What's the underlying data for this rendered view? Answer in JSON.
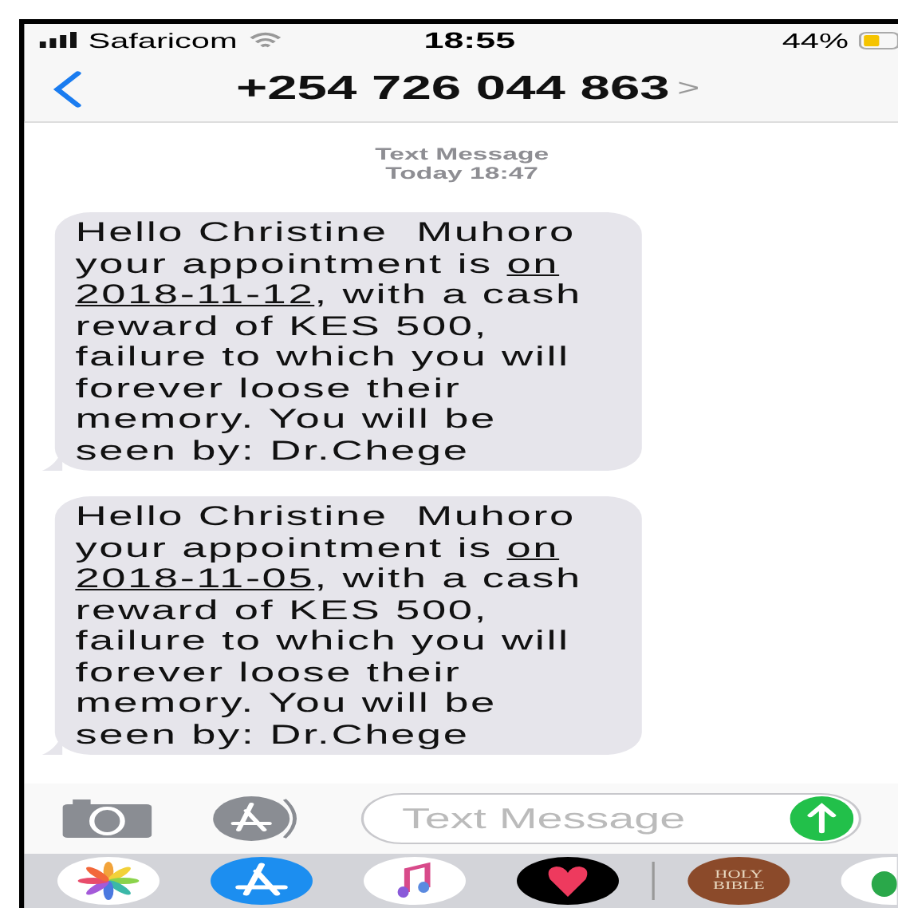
{
  "status_bar": {
    "carrier": "Safaricom",
    "time": "18:55",
    "battery": "44%"
  },
  "nav": {
    "title": "+254 726 044 863",
    "chevron": ">"
  },
  "thread_header": {
    "label": "Text Message",
    "time": "Today 18:47"
  },
  "messages": [
    {
      "before": "Hello Christine  Muhoro\nyour appointment is ",
      "links": [
        "on",
        "2018-11-12"
      ],
      "after": ", with a cash\nreward of KES 500,\nfailure to which you will\nforever loose their\nmemory. You will be\nseen by: Dr.Chege"
    },
    {
      "before": "Hello Christine  Muhoro\nyour appointment is ",
      "links": [
        "on",
        "2018-11-05"
      ],
      "after": ", with a cash\nreward of KES 500,\nfailure to which you will\nforever loose their\nmemory. You will be\nseen by: Dr.Chege"
    }
  ],
  "input": {
    "placeholder": "Text Message"
  },
  "dock": [
    {
      "kind": "photos"
    },
    {
      "kind": "appstore"
    },
    {
      "kind": "music"
    },
    {
      "kind": "heart"
    },
    {
      "kind": "bible",
      "label": "HOLY\nBIBLE"
    },
    {
      "kind": "partial"
    }
  ]
}
